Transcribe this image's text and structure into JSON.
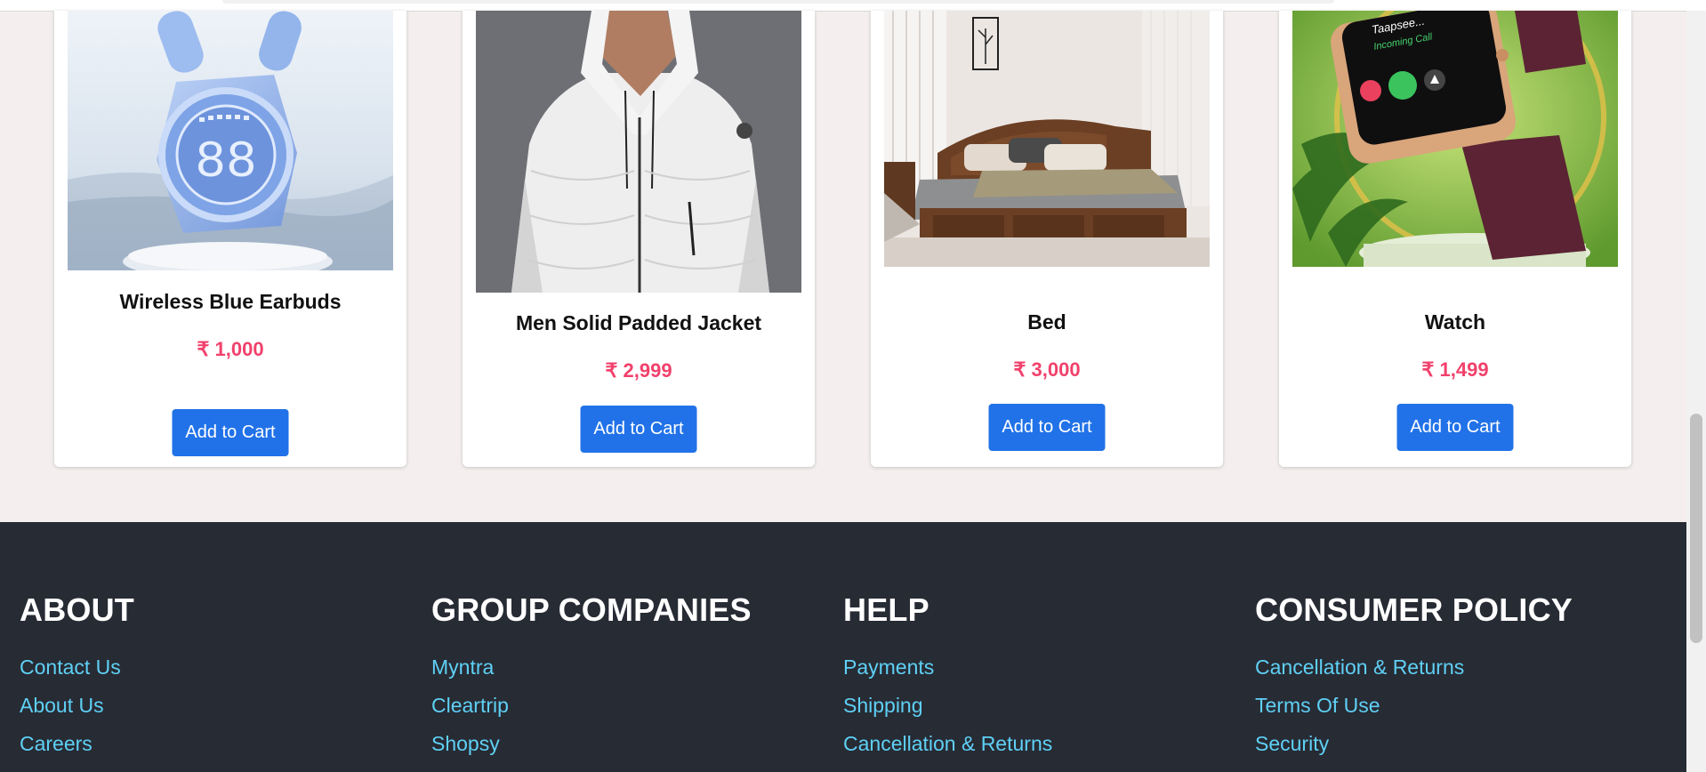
{
  "products": [
    {
      "name": "Wireless Blue Earbuds",
      "price": "₹ 1,000",
      "button": "Add to Cart",
      "image_icon": "earbuds-image"
    },
    {
      "name": "Men Solid Padded Jacket",
      "price": "₹ 2,999",
      "button": "Add to Cart",
      "image_icon": "jacket-image"
    },
    {
      "name": "Bed",
      "price": "₹ 3,000",
      "button": "Add to Cart",
      "image_icon": "bed-image"
    },
    {
      "name": "Watch",
      "price": "₹ 1,499",
      "button": "Add to Cart",
      "image_icon": "watch-image"
    }
  ],
  "watch_screen": {
    "caller": "Taapsee...",
    "status": "Incoming Call"
  },
  "earbuds_display": "88",
  "footer": {
    "columns": [
      {
        "title": "ABOUT",
        "links": [
          "Contact Us",
          "About Us",
          "Careers"
        ]
      },
      {
        "title": "GROUP COMPANIES",
        "links": [
          "Myntra",
          "Cleartrip",
          "Shopsy"
        ]
      },
      {
        "title": "HELP",
        "links": [
          "Payments",
          "Shipping",
          "Cancellation & Returns"
        ]
      },
      {
        "title": "CONSUMER POLICY",
        "links": [
          "Cancellation & Returns",
          "Terms Of Use",
          "Security"
        ]
      }
    ]
  },
  "colors": {
    "page_bg": "#f4efee",
    "accent_button": "#2172e8",
    "price": "#f1416c",
    "footer_bg": "#272b34",
    "footer_link": "#5fd0f5"
  }
}
